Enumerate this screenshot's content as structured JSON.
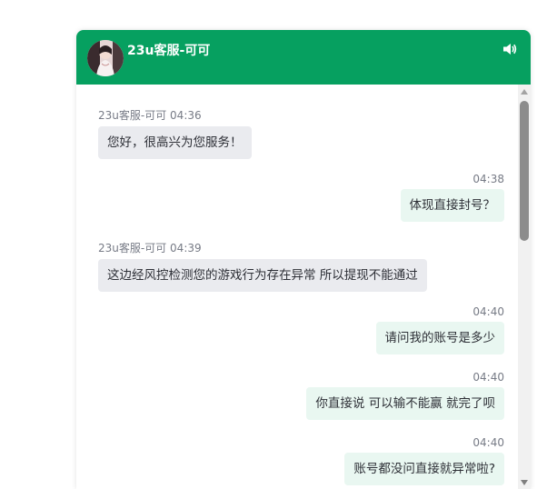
{
  "header": {
    "agent_name": "23u客服-可可",
    "avatar_icon": "agent-avatar",
    "sound_icon": "speaker-icon",
    "background_color": "#06a060"
  },
  "messages": [
    {
      "side": "left",
      "sender": "23u客服-可可",
      "time": "04:36",
      "text": "您好，很高兴为您服务！"
    },
    {
      "side": "right",
      "time": "04:38",
      "text": "体现直接封号？"
    },
    {
      "side": "left",
      "sender": "23u客服-可可",
      "time": "04:39",
      "text": "这边经风控检测您的游戏行为存在异常 所以提现不能通过"
    },
    {
      "side": "right",
      "time": "04:40",
      "text": "请问我的账号是多少"
    },
    {
      "side": "right",
      "time": "04:40",
      "text": "你直接说 可以输不能赢 就完了呗"
    },
    {
      "side": "right",
      "time": "04:40",
      "text": "账号都没问直接就异常啦?"
    }
  ]
}
